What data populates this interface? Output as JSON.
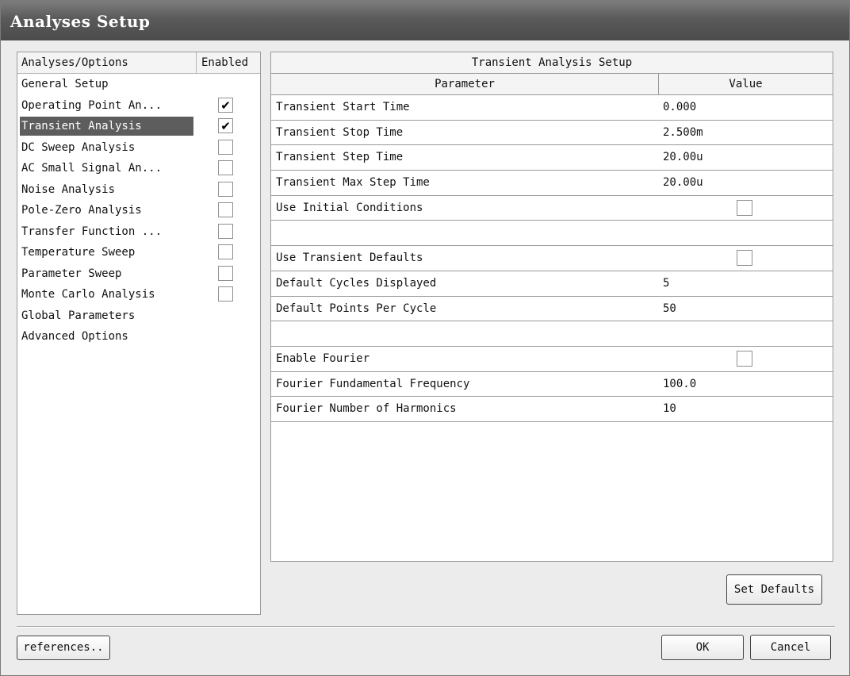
{
  "window": {
    "title": "Analyses Setup"
  },
  "options_list": {
    "header": {
      "name": "Analyses/Options",
      "enabled": "Enabled"
    },
    "items": [
      {
        "label": "General Setup",
        "checkbox": null
      },
      {
        "label": "Operating Point An...",
        "checkbox": true
      },
      {
        "label": "Transient Analysis",
        "checkbox": true,
        "selected": true
      },
      {
        "label": "DC Sweep Analysis",
        "checkbox": false
      },
      {
        "label": "AC Small Signal An...",
        "checkbox": false
      },
      {
        "label": "Noise Analysis",
        "checkbox": false
      },
      {
        "label": "Pole-Zero Analysis",
        "checkbox": false
      },
      {
        "label": "Transfer Function ...",
        "checkbox": false
      },
      {
        "label": "Temperature Sweep",
        "checkbox": false
      },
      {
        "label": "Parameter Sweep",
        "checkbox": false
      },
      {
        "label": "Monte Carlo Analysis",
        "checkbox": false
      },
      {
        "label": "Global Parameters",
        "checkbox": null
      },
      {
        "label": "Advanced Options",
        "checkbox": null
      }
    ]
  },
  "setup_grid": {
    "title": "Transient Analysis Setup",
    "columns": {
      "parameter": "Parameter",
      "value": "Value"
    },
    "rows": [
      {
        "parameter": "Transient Start Time",
        "value": "0.000",
        "type": "text"
      },
      {
        "parameter": "Transient Stop Time",
        "value": "2.500m",
        "type": "text"
      },
      {
        "parameter": "Transient Step Time",
        "value": "20.00u",
        "type": "text"
      },
      {
        "parameter": "Transient Max Step Time",
        "value": "20.00u",
        "type": "text"
      },
      {
        "parameter": "Use Initial Conditions",
        "value": false,
        "type": "checkbox"
      },
      {
        "parameter": "",
        "value": "",
        "type": "blank"
      },
      {
        "parameter": "Use Transient Defaults",
        "value": false,
        "type": "checkbox"
      },
      {
        "parameter": "Default Cycles Displayed",
        "value": "5",
        "type": "text"
      },
      {
        "parameter": "Default Points Per Cycle",
        "value": "50",
        "type": "text"
      },
      {
        "parameter": "",
        "value": "",
        "type": "blank"
      },
      {
        "parameter": "Enable Fourier",
        "value": false,
        "type": "checkbox"
      },
      {
        "parameter": "Fourier Fundamental Frequency",
        "value": "100.0",
        "type": "text"
      },
      {
        "parameter": "Fourier Number of Harmonics",
        "value": "10",
        "type": "text"
      }
    ]
  },
  "buttons": {
    "set_defaults": "Set Defaults",
    "preferences": "references..",
    "ok": "OK",
    "cancel": "Cancel"
  },
  "icons": {
    "checked": "checkmark-icon"
  }
}
